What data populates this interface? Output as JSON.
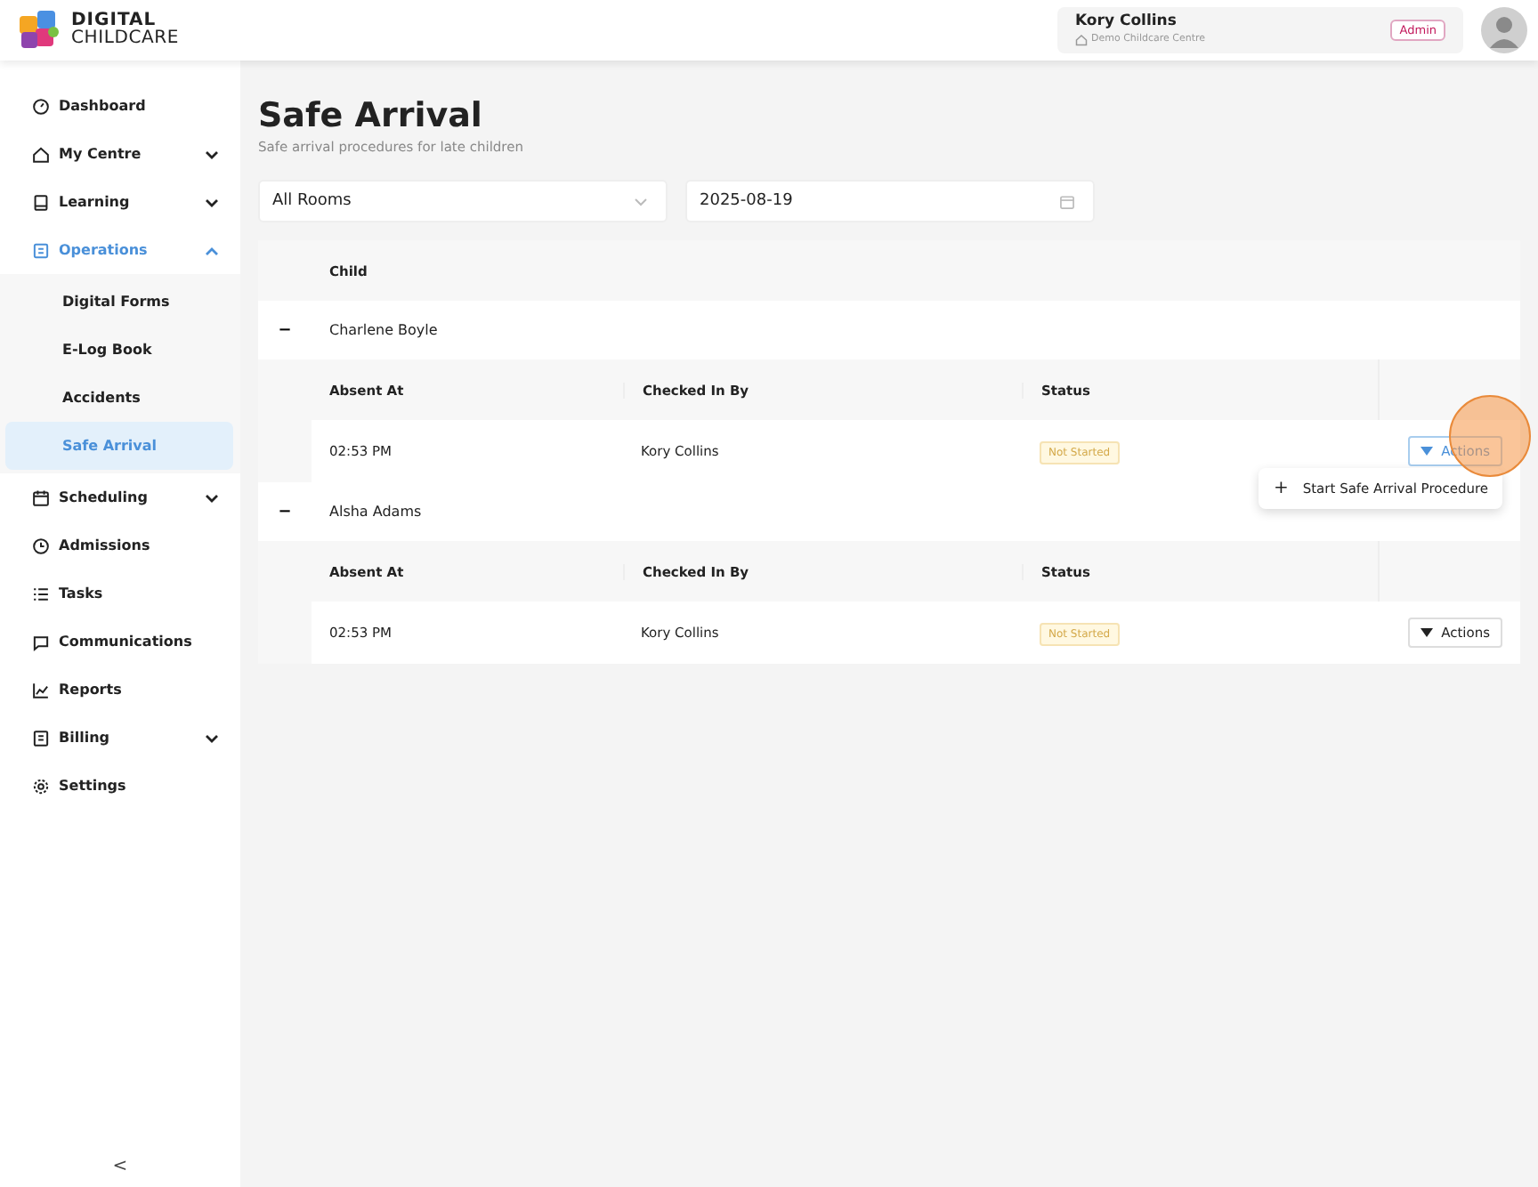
{
  "brand": {
    "line1": "DIGITAL",
    "line2": "CHILDCARE"
  },
  "user": {
    "name": "Kory Collins",
    "centre": "Demo Childcare Centre",
    "role": "Admin"
  },
  "sidebar": {
    "items": [
      {
        "label": "Dashboard",
        "selected": false
      },
      {
        "label": "My Centre",
        "selected": false,
        "expanded": false
      },
      {
        "label": "Learning",
        "selected": false,
        "expanded": false
      },
      {
        "label": "Operations",
        "selected": true,
        "expanded": true,
        "children": [
          {
            "label": "Digital Forms",
            "selected": false
          },
          {
            "label": "E-Log Book",
            "selected": false
          },
          {
            "label": "Accidents",
            "selected": false
          },
          {
            "label": "Safe Arrival",
            "selected": true
          }
        ]
      },
      {
        "label": "Scheduling",
        "selected": false,
        "expanded": false
      },
      {
        "label": "Admissions",
        "selected": false
      },
      {
        "label": "Tasks",
        "selected": false
      },
      {
        "label": "Communications",
        "selected": false
      },
      {
        "label": "Reports",
        "selected": false
      },
      {
        "label": "Billing",
        "selected": false,
        "expanded": false
      },
      {
        "label": "Settings",
        "selected": false
      }
    ],
    "collapse": "<"
  },
  "page": {
    "title": "Safe Arrival",
    "subtitle": "Safe arrival procedures for late children"
  },
  "filters": {
    "room": "All Rooms",
    "date": "2025-08-19"
  },
  "table": {
    "column": "Child",
    "expand_glyph": "−",
    "groups": [
      {
        "child": "Charlene Boyle",
        "columns": [
          "Absent At",
          "Checked In By",
          "Status"
        ],
        "rows": [
          {
            "absent_at": "02:53 PM",
            "checked_in_by": "Kory Collins",
            "status": "Not Started",
            "actions": "Actions",
            "menu_open": true
          }
        ]
      },
      {
        "child": "Alsha Adams",
        "columns": [
          "Absent At",
          "Checked In By",
          "Status"
        ],
        "rows": [
          {
            "absent_at": "02:53 PM",
            "checked_in_by": "Kory Collins",
            "status": "Not Started",
            "actions": "Actions",
            "menu_open": false
          }
        ]
      }
    ]
  },
  "menu": {
    "items": [
      {
        "glyph": "+",
        "label": "Start Safe Arrival Procedure"
      }
    ]
  }
}
